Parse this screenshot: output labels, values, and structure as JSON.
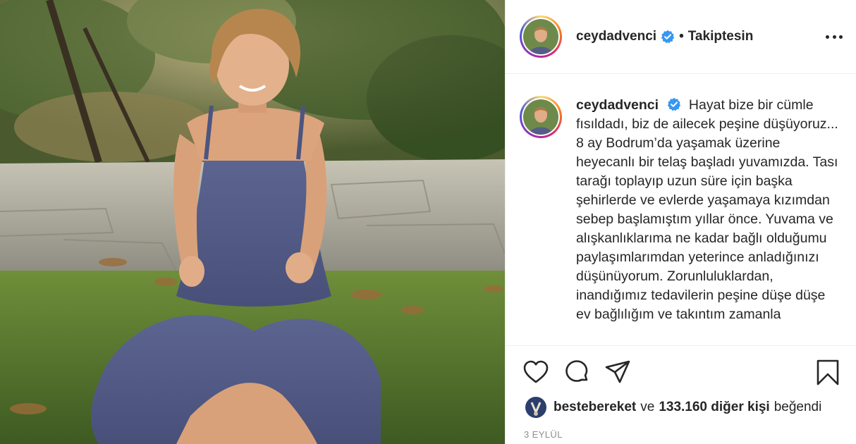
{
  "post": {
    "username": "ceydadvenci",
    "follow_label": "Takiptesin",
    "separator": "•",
    "caption": "Hayat bize bir cümle fısıldadı, biz de ailecek peşine düşüyoruz... 8 ay Bodrum’da yaşamak üzerine heyecanlı bir telaş başladı yuvamızda. Tası tarağı toplayıp uzun süre için başka şehirlerde ve evlerde yaşamaya kızımdan sebep başlamıştım yıllar önce. Yuvama ve alışkanlıklarıma ne kadar bağlı olduğumu paylaşımlarımdan yeterince anladığınızı düşünüyorum. Zorunluluklardan, inandığımız tedavilerin peşine düşe düşe ev bağlılığım ve takıntım zamanla",
    "likes": {
      "user": "bestebereket",
      "conjunction": "ve",
      "count_text": "133.160 diğer kişi",
      "suffix": "beğendi"
    },
    "date": "3 EYLÜL"
  },
  "icons": {
    "verified": "verified-badge-icon",
    "more": "more-options-icon",
    "like": "heart-icon",
    "comment": "comment-icon",
    "share": "paper-plane-icon",
    "save": "bookmark-icon"
  },
  "colors": {
    "verified": "#3897f0",
    "text": "#262626",
    "muted": "#8e8e8e",
    "border": "#efefef"
  }
}
